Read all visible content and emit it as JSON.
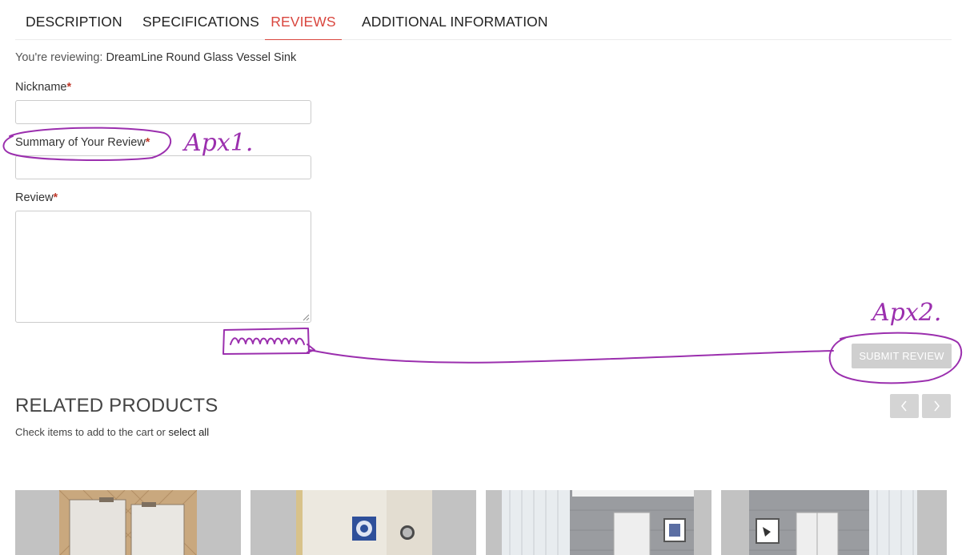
{
  "tabs": [
    {
      "label": "DESCRIPTION",
      "active": false
    },
    {
      "label": "SPECIFICATIONS",
      "active": false
    },
    {
      "label": "REVIEWS",
      "active": true
    },
    {
      "label": "ADDITIONAL INFORMATION",
      "active": false
    }
  ],
  "review_form": {
    "reviewing_prefix": "You're reviewing:",
    "product_name": "DreamLine Round Glass Vessel Sink",
    "nickname_label": "Nickname",
    "summary_label": "Summary of Your Review",
    "review_label": "Review",
    "required_mark": "*",
    "nickname_value": "",
    "summary_value": "",
    "review_value": "",
    "submit_label": "SUBMIT REVIEW"
  },
  "annotations": {
    "note_1": "Apx1.",
    "note_2": "Apx2.",
    "color": "#9b2fae"
  },
  "related": {
    "title": "RELATED PRODUCTS",
    "subtitle": "Check items to add to the cart or",
    "select_all": "select all",
    "prev_icon": "chevron-left-icon",
    "next_icon": "chevron-right-icon",
    "products": [
      {
        "image": "mirror-cabinet-on-tiled-wall"
      },
      {
        "image": "bathroom-wall-with-decor"
      },
      {
        "image": "medicine-cabinet-on-gray-tiles"
      },
      {
        "image": "double-cabinet-on-gray-tiles"
      }
    ]
  },
  "colors": {
    "accent": "#d9463e",
    "required": "#c0392b",
    "button_disabled": "#cfcfcf",
    "annotation": "#9b2fae"
  }
}
